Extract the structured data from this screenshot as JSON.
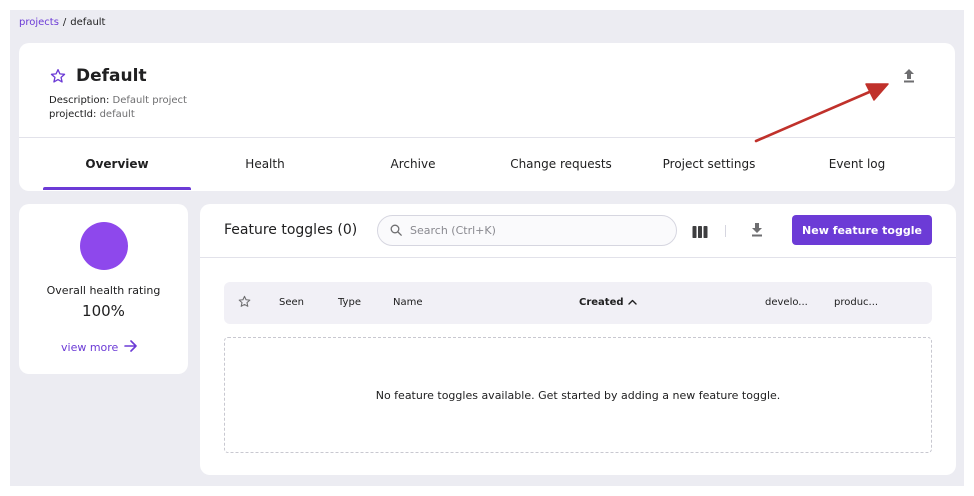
{
  "breadcrumb": {
    "root": "projects",
    "separator": "/",
    "current": "default"
  },
  "project": {
    "title": "Default",
    "description_label": "Description:",
    "description_value": "Default project",
    "id_label": "projectId:",
    "id_value": "default"
  },
  "tabs": [
    {
      "label": "Overview",
      "active": true
    },
    {
      "label": "Health"
    },
    {
      "label": "Archive"
    },
    {
      "label": "Change requests"
    },
    {
      "label": "Project settings"
    },
    {
      "label": "Event log"
    }
  ],
  "health": {
    "label": "Overall health rating",
    "value": "100%",
    "view_more": "view more",
    "circle_color": "#8e48ec"
  },
  "toggles": {
    "title": "Feature toggles (0)",
    "search_placeholder": "Search (Ctrl+K)",
    "new_button": "New feature toggle",
    "columns": {
      "seen": "Seen",
      "type": "Type",
      "name": "Name",
      "created": "Created",
      "env1": "develo...",
      "env2": "produc..."
    },
    "empty_message": "No feature toggles available. Get started by adding a new feature toggle."
  },
  "icons": {
    "favorite": "star-icon",
    "upload": "upload-icon",
    "search": "search-icon",
    "columns": "columns-icon",
    "download": "download-icon",
    "sort": "chevron-up-icon",
    "arrow": "arrow-right-icon"
  },
  "colors": {
    "accent": "#6c3bd6",
    "annotation": "#c0312b"
  }
}
